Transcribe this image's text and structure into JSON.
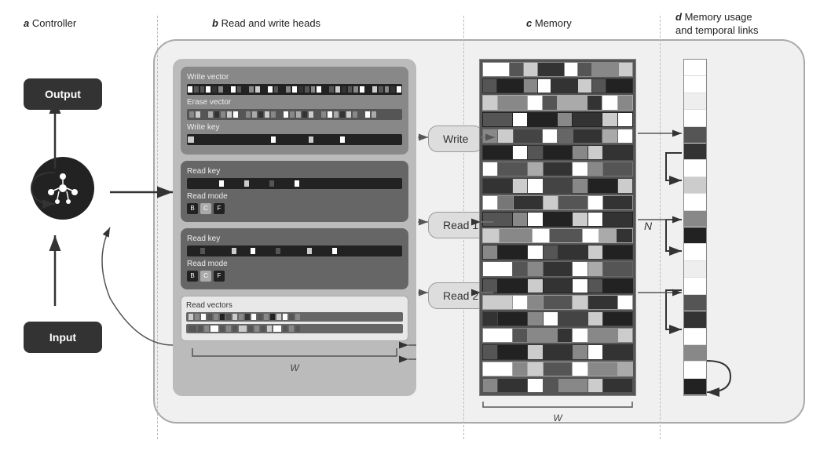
{
  "sections": {
    "a": {
      "label": "a",
      "title": "Controller"
    },
    "b": {
      "label": "b",
      "title": "Read and write heads"
    },
    "c": {
      "label": "c",
      "title": "Memory"
    },
    "d": {
      "label": "d",
      "title": "Memory usage",
      "subtitle": "and temporal links"
    }
  },
  "controller": {
    "output_label": "Output",
    "input_label": "Input"
  },
  "write_head": {
    "write_vector_label": "Write vector",
    "erase_vector_label": "Erase vector",
    "write_key_label": "Write key"
  },
  "read_head_1": {
    "read_key_label": "Read key",
    "read_mode_label": "Read mode",
    "modes": [
      "B",
      "C",
      "F"
    ]
  },
  "read_head_2": {
    "read_key_label": "Read key",
    "read_mode_label": "Read mode",
    "modes": [
      "B",
      "C",
      "F"
    ]
  },
  "read_vectors": {
    "label": "Read vectors"
  },
  "action_buttons": {
    "write": "Write",
    "read1": "Read 1",
    "read2": "Read 2"
  },
  "annotations": {
    "W": "W",
    "N": "N"
  }
}
